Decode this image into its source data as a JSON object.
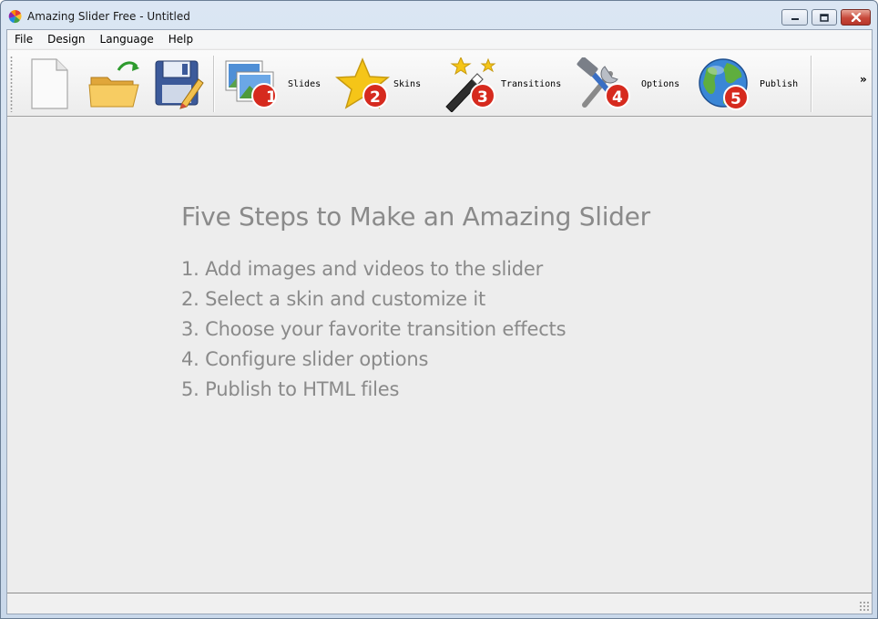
{
  "window": {
    "title": "Amazing Slider Free - Untitled",
    "app_icon": "pinwheel-icon",
    "controls": [
      "minimize-icon",
      "maximize-icon",
      "close-icon"
    ]
  },
  "menubar": {
    "items": [
      {
        "label": "File"
      },
      {
        "label": "Design"
      },
      {
        "label": "Language"
      },
      {
        "label": "Help"
      }
    ]
  },
  "toolbar": {
    "file_buttons": [
      {
        "icon": "new-document-icon"
      },
      {
        "icon": "open-folder-icon"
      },
      {
        "icon": "save-disk-icon"
      }
    ],
    "steps": [
      {
        "label": "Slides",
        "number": "1",
        "icon": "pictures-icon"
      },
      {
        "label": "Skins",
        "number": "2",
        "icon": "star-icon"
      },
      {
        "label": "Transitions",
        "number": "3",
        "icon": "magic-wand-icon"
      },
      {
        "label": "Options",
        "number": "4",
        "icon": "tools-icon"
      },
      {
        "label": "Publish",
        "number": "5",
        "icon": "globe-icon"
      }
    ],
    "overflow": "»"
  },
  "main": {
    "heading": "Five Steps to Make an Amazing Slider",
    "steps": [
      "1. Add images and videos to the slider",
      "2. Select a skin and customize it",
      "3. Choose your favorite transition effects",
      "4. Configure slider options",
      "5. Publish to HTML files"
    ]
  },
  "colors": {
    "text_gray": "#8a8a8a",
    "badge_red": "#d62a1e",
    "window_frame": "#c9d8ea"
  }
}
